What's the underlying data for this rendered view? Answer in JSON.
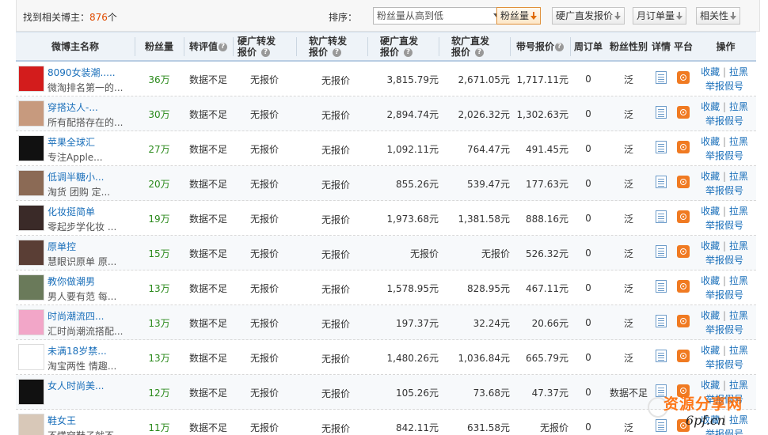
{
  "summary": {
    "prefix": "找到相关博主：",
    "count": "876",
    "suffix": "个"
  },
  "sort": {
    "label": "排序：",
    "selected": "粉丝量从高到低",
    "buttons": [
      "粉丝量",
      "硬广直发报价",
      "月订单量",
      "相关性"
    ]
  },
  "columns": [
    "微博主名称",
    "粉丝量",
    "转评值",
    "硬广转发报价",
    "软广转发报价",
    "硬广直发报价",
    "软广直发报价",
    "带号报价",
    "周订单",
    "粉丝性别",
    "详情",
    "平台",
    "操作"
  ],
  "ops": {
    "fav": "收藏",
    "sep": "|",
    "block": "拉黑",
    "report": "举报假号"
  },
  "rows": [
    {
      "name": "8090女装潮.....",
      "desc": "微淘排名第一的...",
      "fans": "36万",
      "score": "数据不足",
      "hard_fwd": "无报价",
      "soft_fwd": "无报价",
      "hard_post": "3,815.79元",
      "soft_post": "2,671.05元",
      "account": "1,717.11元",
      "weekly": "0",
      "gender": "泛",
      "avatar_bg": "#d31c1c"
    },
    {
      "name": "穿搭达人-...",
      "desc": "所有配搭存在的...",
      "fans": "30万",
      "score": "数据不足",
      "hard_fwd": "无报价",
      "soft_fwd": "无报价",
      "hard_post": "2,894.74元",
      "soft_post": "2,026.32元",
      "account": "1,302.63元",
      "weekly": "0",
      "gender": "泛",
      "avatar_bg": "#c79a7e"
    },
    {
      "name": "苹果全球汇",
      "desc": "专注Apple...",
      "fans": "27万",
      "score": "数据不足",
      "hard_fwd": "无报价",
      "soft_fwd": "无报价",
      "hard_post": "1,092.11元",
      "soft_post": "764.47元",
      "account": "491.45元",
      "weekly": "0",
      "gender": "泛",
      "avatar_bg": "#111111"
    },
    {
      "name": "低调半糖小...",
      "desc": "淘货 团购 定...",
      "fans": "20万",
      "score": "数据不足",
      "hard_fwd": "无报价",
      "soft_fwd": "无报价",
      "hard_post": "855.26元",
      "soft_post": "539.47元",
      "account": "177.63元",
      "weekly": "0",
      "gender": "泛",
      "avatar_bg": "#8b6a55"
    },
    {
      "name": "化妆挺简单",
      "desc": "零起步学化妆 ...",
      "fans": "19万",
      "score": "数据不足",
      "hard_fwd": "无报价",
      "soft_fwd": "无报价",
      "hard_post": "1,973.68元",
      "soft_post": "1,381.58元",
      "account": "888.16元",
      "weekly": "0",
      "gender": "泛",
      "avatar_bg": "#3a2a28"
    },
    {
      "name": "原单控",
      "desc": "慧眼识原单 原...",
      "fans": "15万",
      "score": "数据不足",
      "hard_fwd": "无报价",
      "soft_fwd": "无报价",
      "hard_post": "无报价",
      "soft_post": "无报价",
      "account": "526.32元",
      "weekly": "0",
      "gender": "泛",
      "avatar_bg": "#5a3e35"
    },
    {
      "name": "教你做潮男",
      "desc": "男人要有范 每...",
      "fans": "13万",
      "score": "数据不足",
      "hard_fwd": "无报价",
      "soft_fwd": "无报价",
      "hard_post": "1,578.95元",
      "soft_post": "828.95元",
      "account": "467.11元",
      "weekly": "0",
      "gender": "泛",
      "avatar_bg": "#6a7a5a"
    },
    {
      "name": "时尚潮流四...",
      "desc": "汇时尚潮流搭配...",
      "fans": "13万",
      "score": "数据不足",
      "hard_fwd": "无报价",
      "soft_fwd": "无报价",
      "hard_post": "197.37元",
      "soft_post": "32.24元",
      "account": "20.66元",
      "weekly": "0",
      "gender": "泛",
      "avatar_bg": "#f2a6c8"
    },
    {
      "name": "未满18岁禁...",
      "desc": "淘宝两性 情趣...",
      "fans": "13万",
      "score": "数据不足",
      "hard_fwd": "无报价",
      "soft_fwd": "无报价",
      "hard_post": "1,480.26元",
      "soft_post": "1,036.84元",
      "account": "665.79元",
      "weekly": "0",
      "gender": "泛",
      "avatar_bg": "#ffffff"
    },
    {
      "name": "女人时尚美...",
      "desc": "",
      "fans": "12万",
      "score": "数据不足",
      "hard_fwd": "无报价",
      "soft_fwd": "无报价",
      "hard_post": "105.26元",
      "soft_post": "73.68元",
      "account": "47.37元",
      "weekly": "0",
      "gender": "数据不足",
      "avatar_bg": "#111111"
    },
    {
      "name": "鞋女王",
      "desc": "不懂穿鞋子就不...",
      "fans": "11万",
      "score": "数据不足",
      "hard_fwd": "无报价",
      "soft_fwd": "无报价",
      "hard_post": "842.11元",
      "soft_post": "631.58元",
      "account": "无报价",
      "weekly": "0",
      "gender": "泛",
      "avatar_bg": "#d8c8b8"
    }
  ],
  "watermark": {
    "line1": "资源分享网",
    "line2": "6pf.cn"
  }
}
